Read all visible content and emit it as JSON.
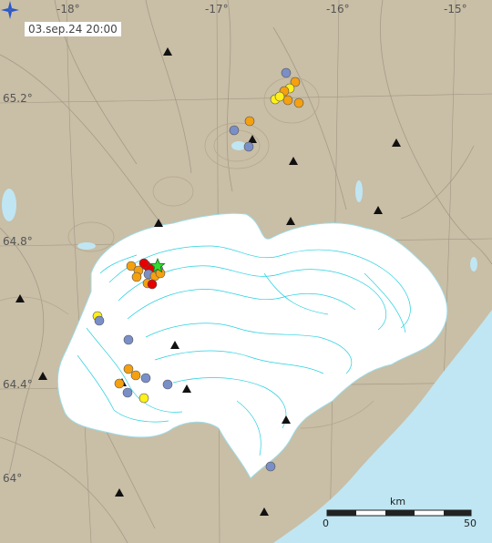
{
  "map": {
    "timestamp": "03.sep.24  20:00",
    "lon_labels": [
      "-18°",
      "-17°",
      "-16°",
      "-15°"
    ],
    "lat_labels": [
      "65.2°",
      "64.8°",
      "64.4°",
      "64°"
    ],
    "scale": {
      "unit": "km",
      "start": "0",
      "end": "50"
    },
    "compass_icon": "compass-icon",
    "colors": {
      "land": "#c9bea6",
      "glacier": "#ffffff",
      "ocean": "#bfe6f2",
      "contour": "#00c8dc",
      "quake_red": "#e60000",
      "quake_orange": "#f5a00f",
      "quake_yellow": "#ffef1a",
      "quake_blue": "#7a8fc8",
      "largest_quake_star": "#33dd33",
      "station": "#111111"
    }
  }
}
